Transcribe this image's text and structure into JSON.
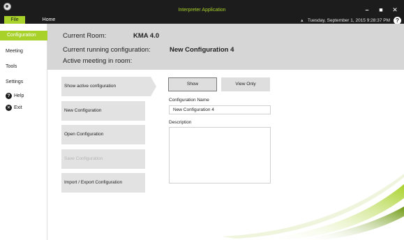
{
  "app": {
    "title": "Interpreter Application",
    "menu_tabs": [
      "File",
      "Home"
    ],
    "status_datetime": "Tuesday, September 1, 2015 9:28:37 PM",
    "window_controls": [
      "minimize-icon",
      "maximize-icon",
      "close-icon"
    ]
  },
  "sidebar": {
    "active_item": "Configuration",
    "items": [
      "Meeting",
      "Tools",
      "Settings"
    ],
    "help_label": "Help",
    "exit_label": "Exit"
  },
  "info": {
    "current_room_label": "Current Room:",
    "current_room_value": "KMA 4.0",
    "running_config_label": "Current running configuration:",
    "running_config_value": "New Configuration 4",
    "active_meeting_label": "Active meeting in room:",
    "active_meeting_value": ""
  },
  "actions": [
    "Show active configuration",
    "New Configuration",
    "Open Configuration",
    "Save Configuration",
    "Import / Export Configuration"
  ],
  "toggle": {
    "show_label": "Show",
    "view_only_label": "View Only"
  },
  "form": {
    "name_label": "Configuration Name",
    "name_value": "New Configuration 4",
    "description_label": "Description",
    "description_value": ""
  },
  "colors": {
    "accent": "#a8d12a",
    "titlebar": "#1c1c1c",
    "info_panel": "#d6d6d6",
    "button": "#e2e2e2"
  }
}
